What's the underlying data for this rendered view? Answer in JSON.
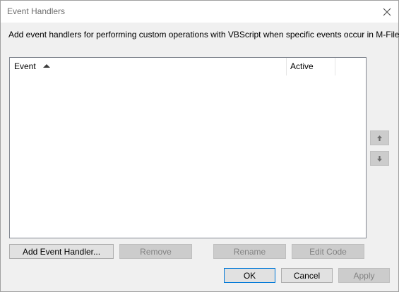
{
  "window": {
    "title": "Event Handlers",
    "close_icon": "close-icon"
  },
  "description": "Add event handlers for performing custom operations with VBScript when specific events occur in M-Files.",
  "list": {
    "columns": [
      {
        "label": "Event",
        "sort": "ascending"
      },
      {
        "label": "Active"
      }
    ],
    "rows": []
  },
  "move_buttons": {
    "up_icon": "arrow-up-icon",
    "down_icon": "arrow-down-icon"
  },
  "buttons": {
    "add": "Add Event Handler...",
    "remove": "Remove",
    "rename": "Rename",
    "edit_code": "Edit Code",
    "ok": "OK",
    "cancel": "Cancel",
    "apply": "Apply"
  },
  "colors": {
    "accent": "#0078d7",
    "disabled_text": "#838383"
  }
}
